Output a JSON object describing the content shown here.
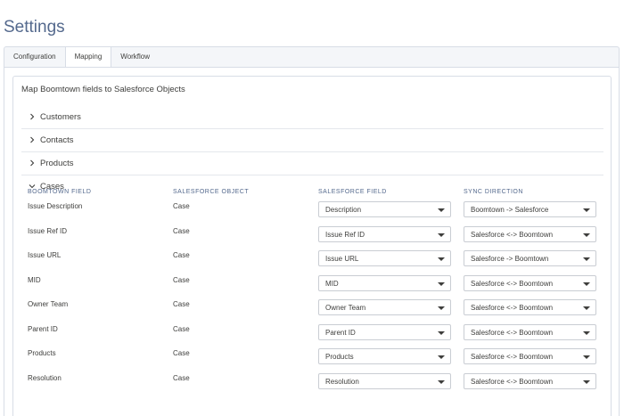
{
  "page": {
    "title": "Settings"
  },
  "tabs": [
    {
      "label": "Configuration",
      "active": false
    },
    {
      "label": "Mapping",
      "active": true
    },
    {
      "label": "Workflow",
      "active": false
    }
  ],
  "card": {
    "title": "Map Boomtown fields to Salesforce Objects"
  },
  "sections": [
    {
      "label": "Customers",
      "expanded": false
    },
    {
      "label": "Contacts",
      "expanded": false
    },
    {
      "label": "Products",
      "expanded": false
    },
    {
      "label": "Cases",
      "expanded": true
    }
  ],
  "columns": {
    "boomtown_field": "BOOMTOWN FIELD",
    "salesforce_object": "SALESFORCE OBJECT",
    "salesforce_field": "SALESFORCE FIELD",
    "sync_direction": "SYNC DIRECTION"
  },
  "rows": [
    {
      "field": "Issue Description",
      "object": "Case",
      "sf_field": "Description",
      "sync": "Boomtown -> Salesforce"
    },
    {
      "field": "Issue Ref ID",
      "object": "Case",
      "sf_field": "Issue Ref ID",
      "sync": "Salesforce <-> Boomtown"
    },
    {
      "field": "Issue URL",
      "object": "Case",
      "sf_field": "Issue URL",
      "sync": "Salesforce -> Boomtown"
    },
    {
      "field": "MID",
      "object": "Case",
      "sf_field": "MID",
      "sync": "Salesforce <-> Boomtown"
    },
    {
      "field": "Owner Team",
      "object": "Case",
      "sf_field": "Owner Team",
      "sync": "Salesforce <-> Boomtown"
    },
    {
      "field": "Parent ID",
      "object": "Case",
      "sf_field": "Parent ID",
      "sync": "Salesforce <-> Boomtown"
    },
    {
      "field": "Products",
      "object": "Case",
      "sf_field": "Products",
      "sync": "Salesforce <-> Boomtown"
    },
    {
      "field": "Resolution",
      "object": "Case",
      "sf_field": "Resolution",
      "sync": "Salesforce <-> Boomtown"
    }
  ],
  "colors": {
    "title": "#54698d",
    "border": "#d8dde6",
    "text": "#3e3e3c"
  }
}
